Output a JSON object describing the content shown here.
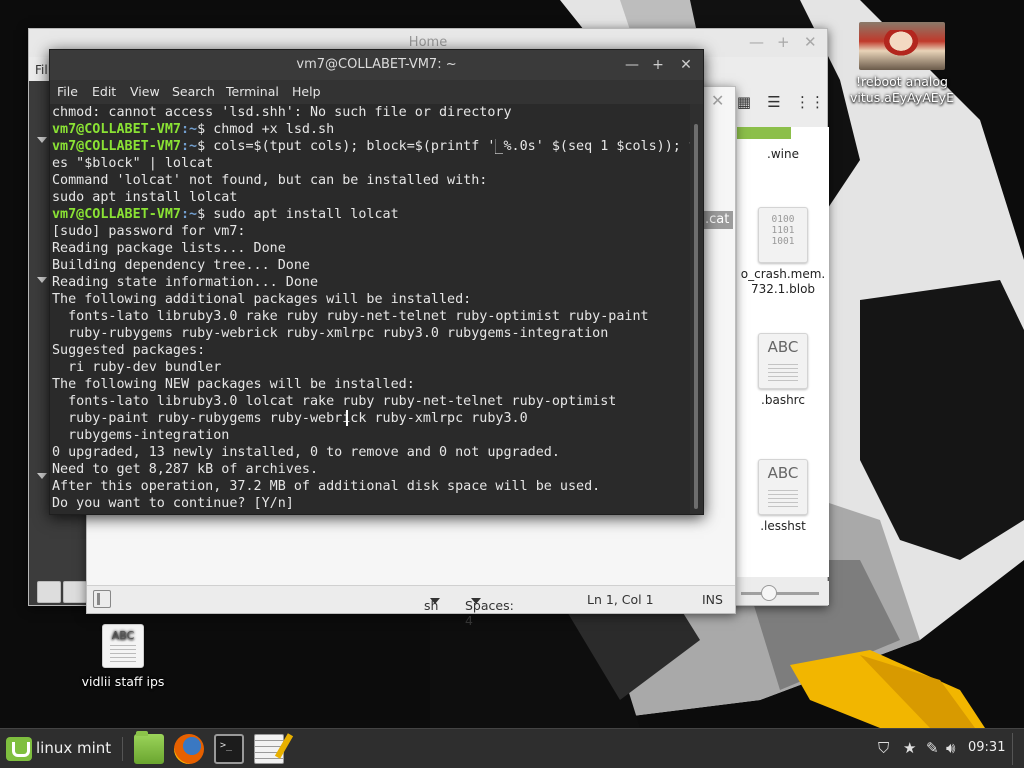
{
  "desktop": {
    "icons": [
      {
        "label_line1": "!reboot analog",
        "label_line2": "vitus.aEyAyAEyE"
      },
      {
        "label": "vidlii staff ips",
        "thumb_text": "ABC"
      }
    ]
  },
  "file_manager": {
    "title": "Home",
    "menu_partial": "Fil",
    "files": [
      {
        "label": ".wine"
      },
      {
        "label_line1": "o_crash.mem.",
        "label_line2": "732.1.blob",
        "thumb_text": "0100\n1101\n1001"
      },
      {
        "label": ".bashrc",
        "thumb_text": "ABC"
      },
      {
        "label": ".lesshst",
        "thumb_text": "ABC"
      }
    ]
  },
  "editor": {
    "tab_partial": ".cat",
    "status": {
      "language": "sh",
      "spaces": "Spaces: 4",
      "position": "Ln 1, Col 1",
      "mode": "INS"
    }
  },
  "terminal": {
    "title": "vm7@COLLABET-VM7: ~",
    "menu": [
      "File",
      "Edit",
      "View",
      "Search",
      "Terminal",
      "Help"
    ],
    "prompt_user": "vm7@COLLABET-VM7",
    "prompt_path": ":~",
    "lines": [
      {
        "text": "chmod: cannot access 'lsd.shh': No such file or directory"
      },
      {
        "prompt": true,
        "cmd": "$ chmod +x lsd.sh"
      },
      {
        "prompt": true,
        "cmd_before": "$ cols=$(tput cols); block=$(printf '",
        "cursor": "█",
        "cmd_after": "%.0s' $(seq 1 $cols)); y"
      },
      {
        "text": "es \"$block\" | lolcat"
      },
      {
        "text": "Command 'lolcat' not found, but can be installed with:"
      },
      {
        "text": "sudo apt install lolcat"
      },
      {
        "prompt": true,
        "cmd": "$ sudo apt install lolcat"
      },
      {
        "text": "[sudo] password for vm7:"
      },
      {
        "text": "Reading package lists... Done"
      },
      {
        "text": "Building dependency tree... Done"
      },
      {
        "text": "Reading state information... Done"
      },
      {
        "text": "The following additional packages will be installed:"
      },
      {
        "text": "  fonts-lato libruby3.0 rake ruby ruby-net-telnet ruby-optimist ruby-paint"
      },
      {
        "text": "  ruby-rubygems ruby-webrick ruby-xmlrpc ruby3.0 rubygems-integration"
      },
      {
        "text": "Suggested packages:"
      },
      {
        "text": "  ri ruby-dev bundler"
      },
      {
        "text": "The following NEW packages will be installed:"
      },
      {
        "text": "  fonts-lato libruby3.0 lolcat rake ruby ruby-net-telnet ruby-optimist"
      },
      {
        "text": "  ruby-paint ruby-rubygems ruby-webrick ruby-xmlrpc ruby3.0"
      },
      {
        "text": "  rubygems-integration"
      },
      {
        "text": "0 upgraded, 13 newly installed, 0 to remove and 0 not upgraded."
      },
      {
        "text": "Need to get 8,287 kB of archives."
      },
      {
        "text": "After this operation, 37.2 MB of additional disk space will be used."
      },
      {
        "text": "Do you want to continue? [Y/n]"
      }
    ]
  },
  "taskbar": {
    "menu_label": "linux mint",
    "clock": "09:31",
    "launchers": [
      "files",
      "firefox",
      "terminal",
      "text-editor"
    ],
    "tray": [
      "shield-icon",
      "star-icon",
      "pen-icon",
      "volume-icon"
    ]
  },
  "colors": {
    "prompt_user": "#8ae234",
    "prompt_path": "#729fcf",
    "terminal_bg": "#2a2a2a",
    "mint_green": "#7fbf3f"
  }
}
